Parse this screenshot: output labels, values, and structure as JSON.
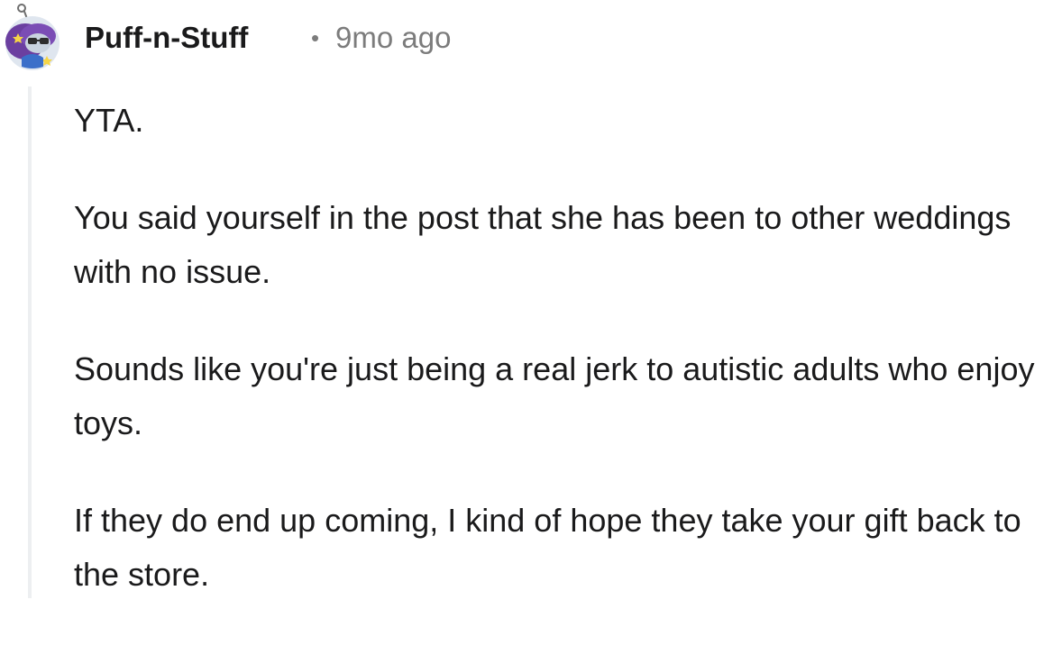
{
  "comment": {
    "author": "Puff-n-Stuff",
    "separator": "•",
    "timestamp": "9mo ago",
    "avatar_icon": "snoo-avatar-icon",
    "paragraphs": [
      "YTA.",
      "You said yourself in the post that she has been to other weddings with no issue.",
      "Sounds like you're just being a real jerk to autistic adults who enjoy toys.",
      "If they do end up coming, I kind of hope they take your gift back to the store."
    ]
  },
  "colors": {
    "text": "#1a1a1b",
    "meta": "#7c7c7c",
    "thread_line": "#edeff1",
    "avatar_purple": "#6b3fa0",
    "avatar_bg": "#dfe6ef"
  }
}
